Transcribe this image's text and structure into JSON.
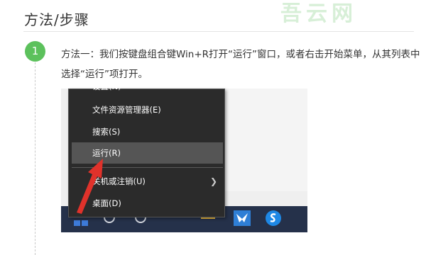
{
  "page": {
    "section_title": "方法/步骤",
    "watermark": "吾云网"
  },
  "step": {
    "number": "1",
    "text": "方法一：我们按键盘组合键Win+R打开“运行”窗口，或者右击开始菜单，从其列表中选择“运行”项打开。"
  },
  "context_menu": {
    "partial_top_item": "设置(N)",
    "items": [
      {
        "label": "文件资源管理器(E)",
        "selected": false
      },
      {
        "label": "搜索(S)",
        "selected": false
      },
      {
        "label": "运行(R)",
        "selected": true
      },
      {
        "label": "关机或注销(U)",
        "selected": false,
        "has_submenu": true
      },
      {
        "label": "桌面(D)",
        "selected": false
      }
    ]
  },
  "colors": {
    "badge": "#5cc15c",
    "arrow": "#e0322b",
    "menu_background": "#2b2b2b",
    "menu_selected": "#555555",
    "taskbar": "#25314a"
  },
  "taskbar_icons": [
    "start-icon",
    "search-icon",
    "cortana-icon",
    "task-view-icon",
    "file-explorer-icon",
    "feedback-bird-icon",
    "sogou-browser-icon"
  ]
}
